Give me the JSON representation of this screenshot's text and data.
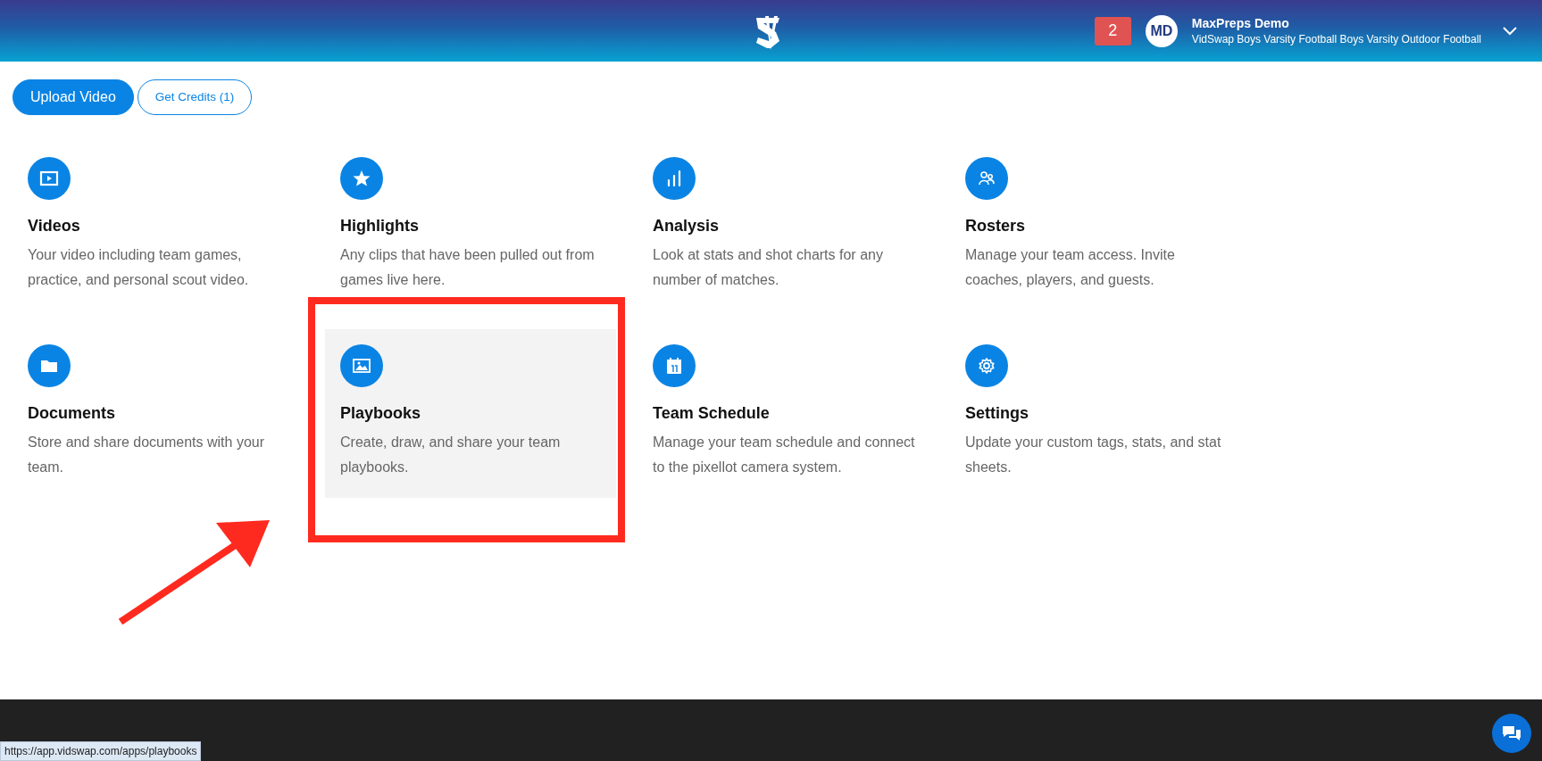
{
  "header": {
    "notifications": "2",
    "user": {
      "initials": "MD",
      "name": "MaxPreps Demo",
      "team": "VidSwap Boys Varsity Football Boys Varsity Outdoor Football"
    }
  },
  "actions": [
    {
      "label": "Upload Video",
      "kind": "primary"
    },
    {
      "label": "Get Credits (1)",
      "kind": "outline"
    }
  ],
  "apps": [
    {
      "title": "Videos",
      "description": "Your video including team games, practice, and personal scout video.",
      "kind": "video",
      "hovered": false
    },
    {
      "title": "Highlights",
      "description": "Any clips that have been pulled out from games live here.",
      "kind": "star",
      "hovered": false
    },
    {
      "title": "Analysis",
      "description": "Look at stats and shot charts for any number of matches.",
      "kind": "bars",
      "hovered": false
    },
    {
      "title": "Rosters",
      "description": "Manage your team access. Invite coaches, players, and guests.",
      "kind": "people",
      "hovered": false
    },
    {
      "title": "Documents",
      "description": "Store and share documents with your team.",
      "kind": "folder",
      "hovered": false
    },
    {
      "title": "Playbooks",
      "description": "Create, draw, and share your team playbooks.",
      "kind": "image",
      "hovered": true
    },
    {
      "title": "Team Schedule",
      "description": "Manage your team schedule and connect to the pixellot camera system.",
      "kind": "calendar",
      "hovered": false
    },
    {
      "title": "Settings",
      "description": "Update your custom tags, stats, and stat sheets.",
      "kind": "gear",
      "hovered": false
    }
  ],
  "status_url": "https://app.vidswap.com/apps/playbooks"
}
